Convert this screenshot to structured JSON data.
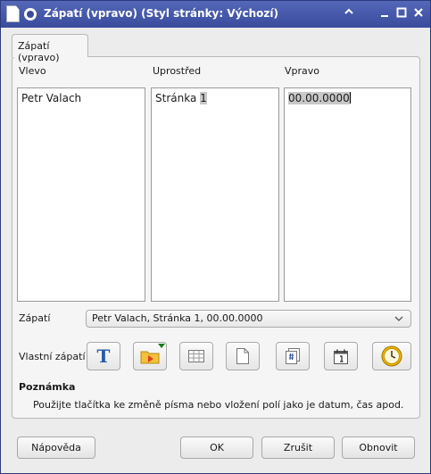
{
  "window": {
    "title": "Zápatí (vpravo) (Styl stránky: Výchozí)"
  },
  "tab": {
    "label": "Zápatí (vpravo)"
  },
  "columns": {
    "left": {
      "label": "Vlevo",
      "text": "Petr Valach"
    },
    "center": {
      "label": "Uprostřed",
      "text_before": "Stránka ",
      "text_selected": "1"
    },
    "right": {
      "label": "Vpravo",
      "text_selected": "00.00.0000"
    }
  },
  "footer": {
    "label": "Zápatí",
    "value": "Petr Valach, Stránka 1, 00.00.0000"
  },
  "custom": {
    "label": "Vlastní zápatí",
    "buttons": [
      {
        "icon": "text-attributes-icon",
        "glyph": "T"
      },
      {
        "icon": "file-name-icon"
      },
      {
        "icon": "sheet-name-icon"
      },
      {
        "icon": "page-icon"
      },
      {
        "icon": "pages-count-icon"
      },
      {
        "icon": "date-icon"
      },
      {
        "icon": "time-icon"
      }
    ]
  },
  "note": {
    "title": "Poznámka",
    "text": "Použijte tlačítka ke změně písma nebo vložení polí jako je datum, čas apod."
  },
  "buttons": {
    "help": "Nápověda",
    "ok": "OK",
    "cancel": "Zrušit",
    "reset": "Obnovit"
  },
  "colors": {
    "titlebar": "#3a4b9c",
    "selection": "#c8c8c8"
  }
}
